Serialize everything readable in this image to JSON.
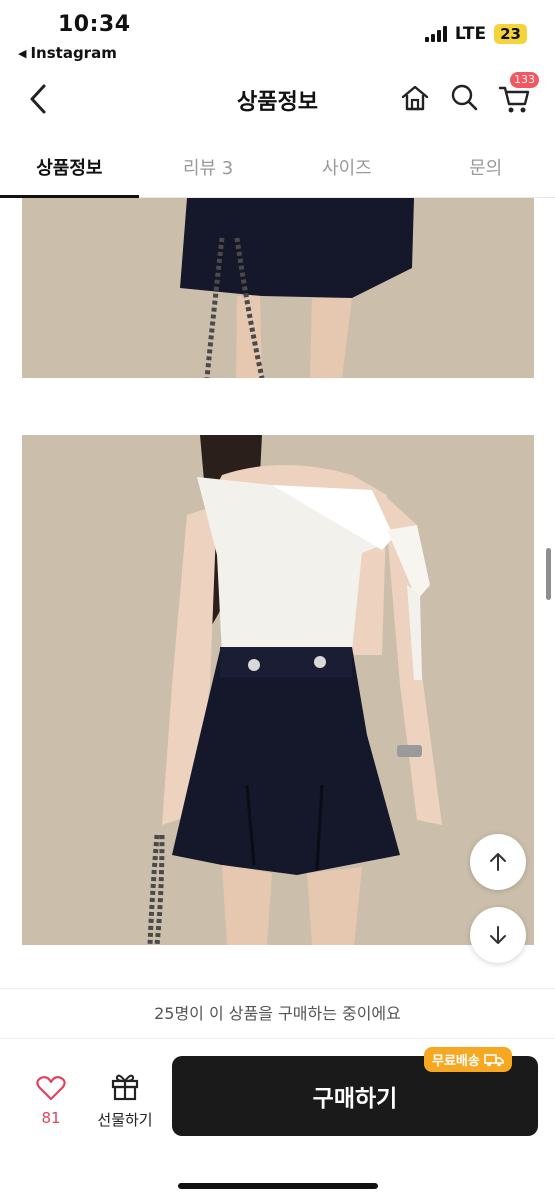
{
  "status_bar": {
    "time": "10:34",
    "back_app": "Instagram",
    "network": "LTE",
    "battery": "23"
  },
  "header": {
    "title": "상품정보",
    "cart_badge": "133",
    "icons": [
      "back-arrow-icon",
      "home-icon",
      "search-icon",
      "cart-icon"
    ]
  },
  "tabs": [
    {
      "label": "상품정보",
      "active": true
    },
    {
      "label": "리뷰 3",
      "active": false
    },
    {
      "label": "사이즈",
      "active": false
    },
    {
      "label": "문의",
      "active": false
    }
  ],
  "content": {
    "images": [
      "product-photo-skirt-chain-bag",
      "product-photo-white-top-navy-skirt"
    ]
  },
  "bottom_bar": {
    "notice": "25명이 이 상품을 구매하는 중이에요",
    "like_count": "81",
    "gift_label": "선물하기",
    "buy_label": "구매하기",
    "shipping_tag": "무료배송"
  },
  "colors": {
    "accent_pink": "#f4575f",
    "like_pink": "#e0445c",
    "shipping_orange": "#f7a823",
    "buy_button": "#1a1a1a"
  }
}
